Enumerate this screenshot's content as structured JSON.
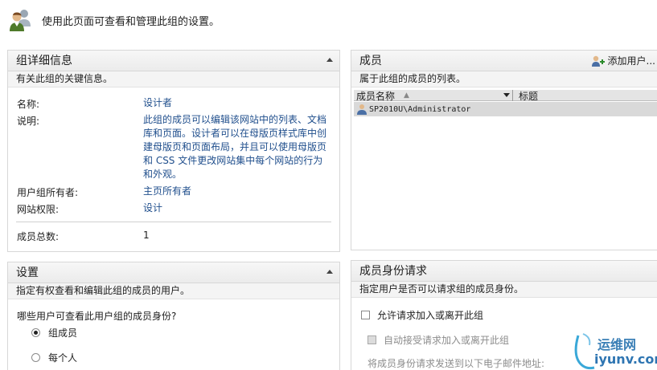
{
  "header": {
    "text": "使用此页面可查看和管理此组的设置。",
    "icon": "group-users-icon"
  },
  "details": {
    "title": "组详细信息",
    "description": "有关此组的关键信息。",
    "fields": {
      "name_label": "名称:",
      "name_value": "设计者",
      "desc_label": "说明:",
      "desc_value": "此组的成员可以编辑该网站中的列表、文档库和页面。设计者可以在母版页样式库中创建母版页和页面布局，并且可以使用母版页和 CSS 文件更改网站集中每个网站的行为和外观。",
      "owner_label": "用户组所有者:",
      "owner_value": "主页所有者",
      "perm_label": "网站权限:",
      "perm_value": "设计",
      "count_label": "成员总数:",
      "count_value": "1"
    }
  },
  "members": {
    "title": "成员",
    "add_user_label": "添加用户...",
    "description": "属于此组的成员的列表。",
    "columns": {
      "name": "成员名称",
      "title": "标题"
    },
    "rows": [
      {
        "name": "SP2010U\\Administrator"
      }
    ]
  },
  "settings": {
    "title": "设置",
    "description": "指定有权查看和编辑此组的成员的用户。",
    "question": "哪些用户可查看此用户组的成员身份?",
    "options": [
      {
        "label": "组成员",
        "selected": true
      },
      {
        "label": "每个人",
        "selected": false
      }
    ]
  },
  "requests": {
    "title": "成员身份请求",
    "description": "指定用户是否可以请求组的成员身份。",
    "allow_label": "允许请求加入或离开此组",
    "auto_accept_label": "自动接受请求加入或离开此组",
    "email_label": "将成员身份请求发送到以下电子邮件地址:"
  },
  "watermark": {
    "line1": "运维网",
    "line2": "iyunv.com"
  },
  "colors": {
    "link": "#1f4e8c",
    "panel_border": "#d7d7d7",
    "title_bg": "#ebebeb"
  }
}
